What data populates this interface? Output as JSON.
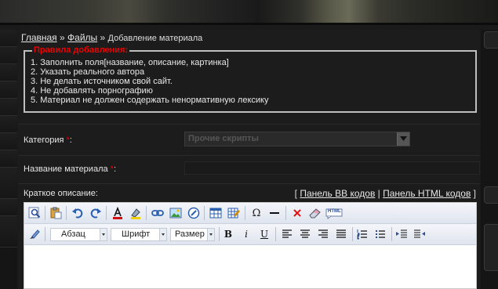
{
  "breadcrumb": {
    "home": "Главная",
    "sep1": " » ",
    "files": "Файлы",
    "sep2": " » ",
    "current": "Добавление материала"
  },
  "rules": {
    "title": "Правила добавления:",
    "items": [
      "1. Заполнить поля[название, описание, картинка]",
      "2. Указать реального автора",
      "3. Не делать источником свой сайт.",
      "4. Не добавлять порнографию",
      "5. Материал не должен содержать ненормативную лексику"
    ]
  },
  "form": {
    "category_label": "Категория ",
    "category_suffix": ":",
    "required_mark": "*",
    "category_value": "Прочие скрипты",
    "name_label": "Название материала ",
    "name_suffix": ":",
    "name_value": "",
    "short_desc_label": "Краткое описание:"
  },
  "panel_links": {
    "open": "[ ",
    "bb": "Панель BB кодов",
    "sep": " | ",
    "html": "Панель HTML кодов",
    "close": " ]"
  },
  "editor": {
    "paragraph_select": "Абзац",
    "font_select": "Шрифт",
    "size_select": "Размер",
    "bold": "B",
    "italic": "i",
    "underline": "U",
    "omega": "Ω",
    "html_label": "HTML"
  },
  "colors": {
    "required": "#e00000",
    "rules_title": "#e00000",
    "toolbar_bg": "#e6ebf3"
  }
}
